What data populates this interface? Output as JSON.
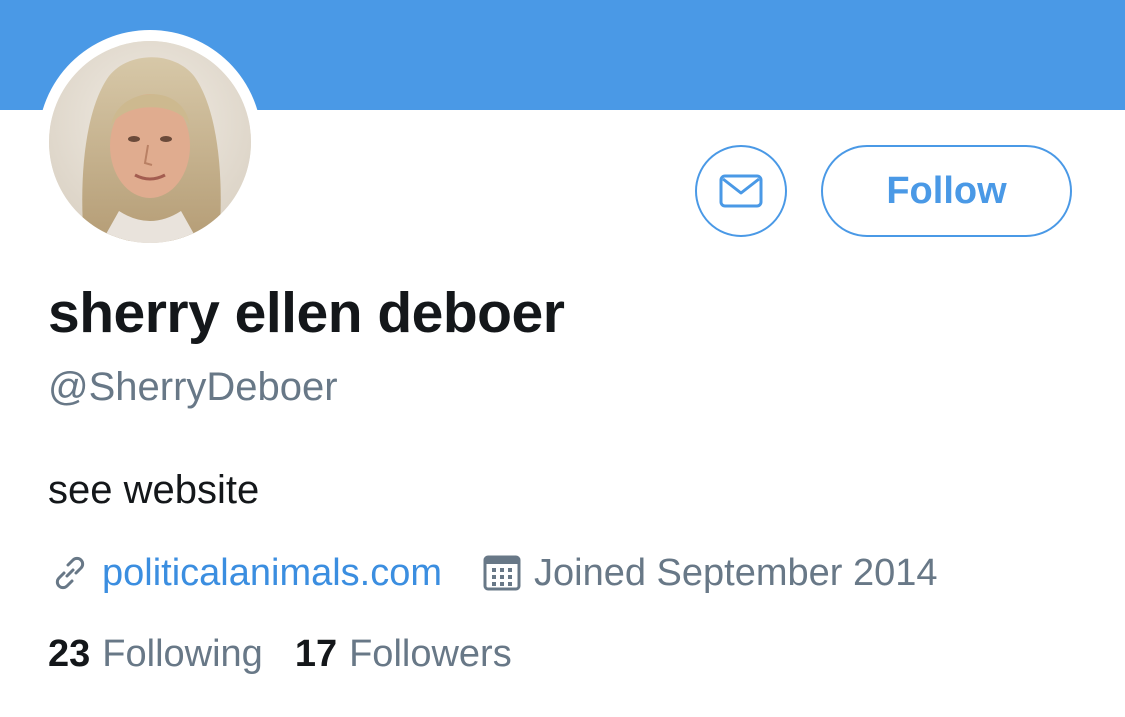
{
  "profile": {
    "display_name": "sherry ellen deboer",
    "handle": "@SherryDeboer",
    "bio": "see website",
    "website": "politicalanimals.com",
    "joined": "Joined September 2014",
    "avatar_icon": "profile-photo"
  },
  "actions": {
    "message_icon": "envelope-icon",
    "follow_label": "Follow"
  },
  "stats": {
    "following_count": "23",
    "following_label": "Following",
    "followers_count": "17",
    "followers_label": "Followers"
  },
  "colors": {
    "banner": "#4a99e6",
    "accent": "#4a99e6",
    "link": "#3b8ee0",
    "text_primary": "#14171a",
    "text_secondary": "#687887"
  },
  "icons": {
    "link": "link-icon",
    "calendar": "calendar-icon"
  }
}
